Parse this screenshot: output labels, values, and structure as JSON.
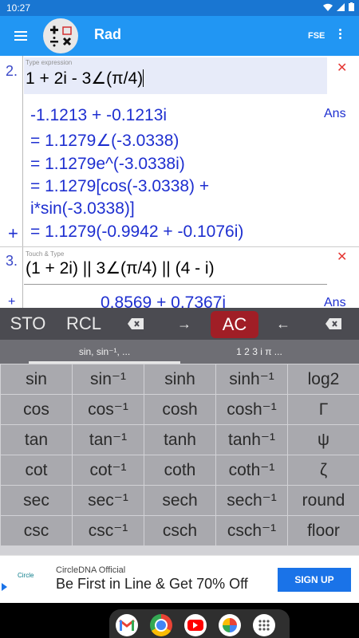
{
  "status": {
    "time": "10:27"
  },
  "appbar": {
    "title": "Rad",
    "mode": "FSE"
  },
  "blocks": [
    {
      "num": "2.",
      "hint": "Type expression",
      "expr": "1 + 2i - 3∠(π/4)",
      "close": "✕",
      "results": [
        "-1.1213 + -0.1213i",
        "= 1.1279∠(-3.0338)",
        "= 1.1279e^(-3.0338i)",
        "= 1.1279[cos(-3.0338) +",
        "i*sin(-3.0338)]",
        "= 1.1279(-0.9942 + -0.1076i)"
      ],
      "ans": "Ans",
      "plus": "+"
    },
    {
      "num": "3.",
      "hint": "Touch & Type",
      "expr": "(1 + 2i) || 3∠(π/4) || (4 - i)",
      "close": "✕",
      "result_partial": "0.8569 + 0.7367i",
      "ans": "Ans",
      "plus": "+"
    }
  ],
  "keyboard": {
    "toprow": {
      "sto": "STO",
      "rcl": "RCL",
      "right_arrow": "→",
      "ac": "AC",
      "left_arrow": "←"
    },
    "tabs": [
      "sin, sin⁻¹, ...",
      "1 2 3 i π ..."
    ],
    "keys": [
      [
        "sin",
        "sin⁻¹",
        "sinh",
        "sinh⁻¹",
        "log2"
      ],
      [
        "cos",
        "cos⁻¹",
        "cosh",
        "cosh⁻¹",
        "Γ"
      ],
      [
        "tan",
        "tan⁻¹",
        "tanh",
        "tanh⁻¹",
        "ψ"
      ],
      [
        "cot",
        "cot⁻¹",
        "coth",
        "coth⁻¹",
        "ζ"
      ],
      [
        "sec",
        "sec⁻¹",
        "sech",
        "sech⁻¹",
        "round"
      ],
      [
        "csc",
        "csc⁻¹",
        "csch",
        "csch⁻¹",
        "floor"
      ]
    ]
  },
  "ad": {
    "logo": "Circle",
    "brand": "CircleDNA Official",
    "headline": "Be First in Line & Get 70% Off",
    "cta": "SIGN UP"
  },
  "colors": {
    "appbar": "#2196f3",
    "statusbar": "#1976d2",
    "result": "#1e2fd0",
    "ac": "#a01e26"
  }
}
